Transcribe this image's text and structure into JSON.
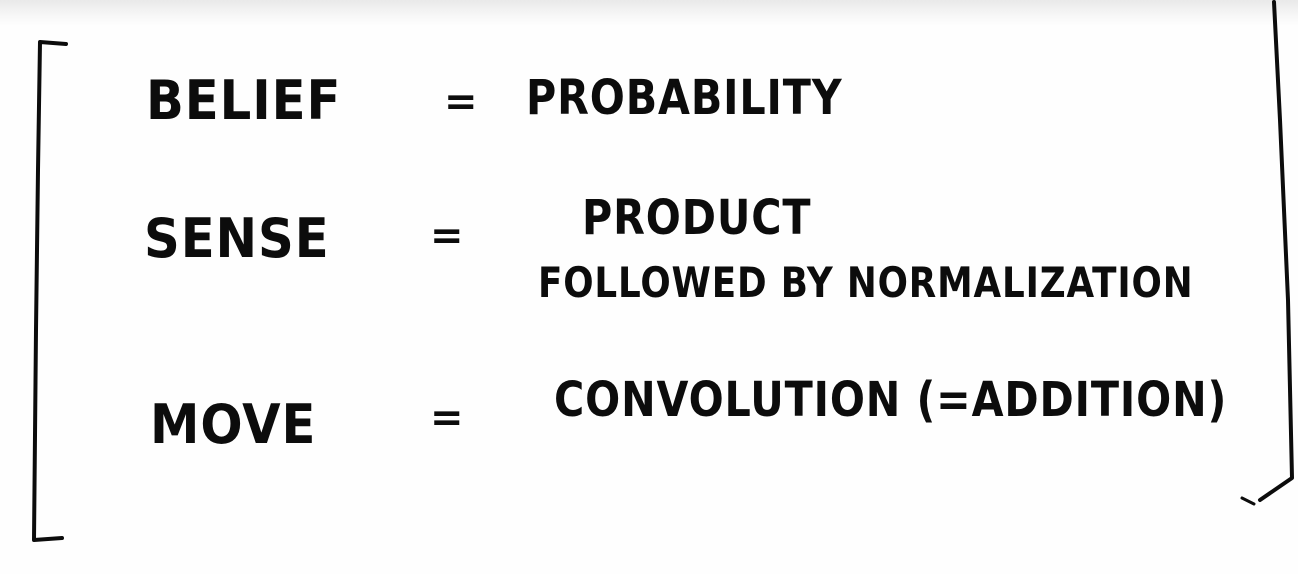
{
  "rows": [
    {
      "term": "BELIEF",
      "operator": "=",
      "definition": "PROBABILITY"
    },
    {
      "term": "SENSE",
      "operator": "=",
      "definition_line1": "PRODUCT",
      "definition_line2": "FOLLOWED BY NORMALIZATION"
    },
    {
      "term": "MOVE",
      "operator": "=",
      "definition": "CONVOLUTION (=ADDITION)"
    }
  ],
  "ink_color": "#0c0c0c",
  "paper_color": "#fefefe"
}
